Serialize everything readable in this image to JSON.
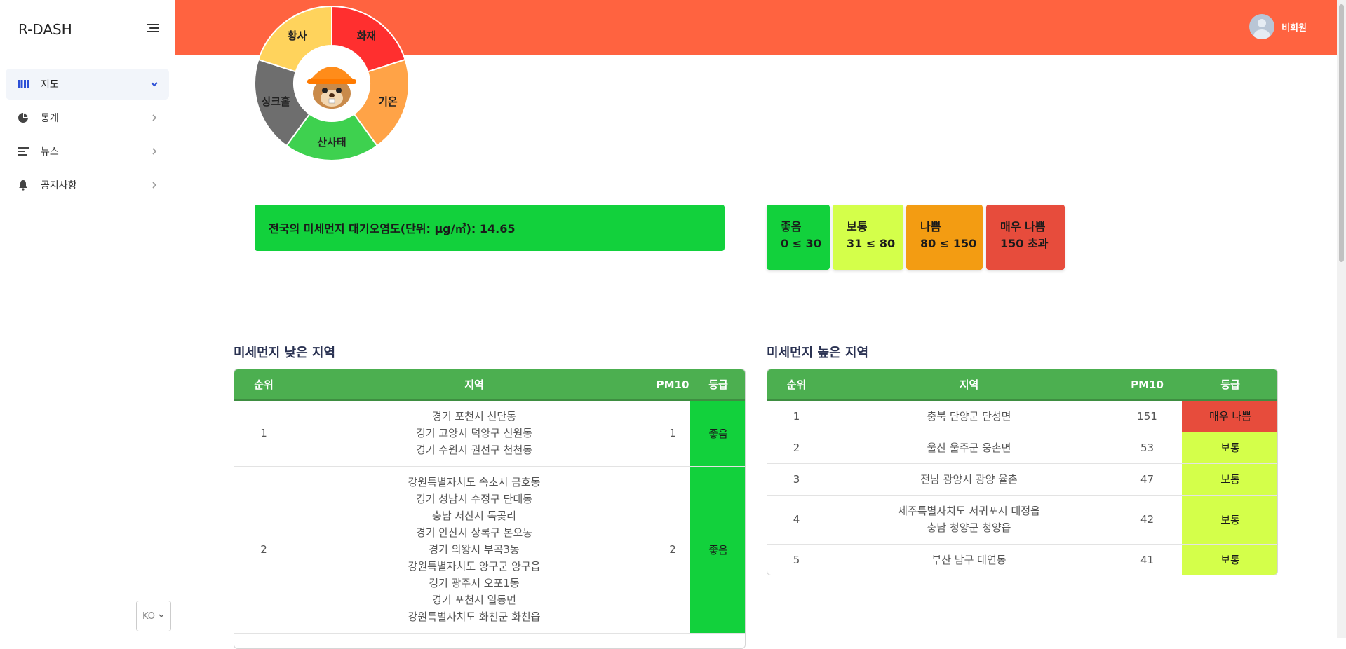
{
  "brand": "R-DASH",
  "sidebar": {
    "items": [
      {
        "label": "지도",
        "icon": "map-icon"
      },
      {
        "label": "통계",
        "icon": "pie-chart-icon"
      },
      {
        "label": "뉴스",
        "icon": "news-lines-icon"
      },
      {
        "label": "공지사항",
        "icon": "bell-icon"
      }
    ],
    "language": "KO"
  },
  "header": {
    "user_name": "비회원"
  },
  "disaster_wheel": {
    "segments": [
      {
        "label": "화재",
        "color": "#ff2f2f"
      },
      {
        "label": "기온",
        "color": "#ffa347"
      },
      {
        "label": "산사태",
        "color": "#3ed14f"
      },
      {
        "label": "싱크홀",
        "color": "#6e6e6e"
      },
      {
        "label": "황사",
        "color": "#ffd35c"
      }
    ],
    "mascot": "beaver-hardhat-mascot"
  },
  "national": {
    "text": "전국의 미세먼지 대기오염도(단위: μg/㎥): 14.65"
  },
  "grades": [
    {
      "name": "좋음",
      "range": "0 ≤ 30",
      "color": "#12d13c"
    },
    {
      "name": "보통",
      "range": "31 ≤ 80",
      "color": "#d4ff4a"
    },
    {
      "name": "나쁨",
      "range": "80 ≤ 150",
      "color": "#f39c12"
    },
    {
      "name": "매우 나쁨",
      "range": "150 초과",
      "color": "#e74c3c"
    }
  ],
  "low_table": {
    "title": "미세먼지 낮은 지역",
    "headers": [
      "순위",
      "지역",
      "PM10",
      "등급"
    ],
    "rows": [
      {
        "rank": "1",
        "regions": [
          "경기 포천시 선단동",
          "경기 고양시 덕양구 신원동",
          "경기 수원시 권선구 천천동"
        ],
        "pm10": "1",
        "grade": "좋음"
      },
      {
        "rank": "2",
        "regions": [
          "강원특별자치도 속초시 금호동",
          "경기 성남시 수정구 단대동",
          "충남 서산시 독곶리",
          "경기 안산시 상록구 본오동",
          "경기 의왕시 부곡3동",
          "강원특별자치도 양구군 양구읍",
          "경기 광주시 오포1동",
          "경기 포천시 일동면",
          "강원특별자치도 화천군 화천읍"
        ],
        "pm10": "2",
        "grade": "좋음"
      }
    ]
  },
  "high_table": {
    "title": "미세먼지 높은 지역",
    "headers": [
      "순위",
      "지역",
      "PM10",
      "등급"
    ],
    "rows": [
      {
        "rank": "1",
        "regions": [
          "충북 단양군 단성면"
        ],
        "pm10": "151",
        "grade": "매우 나쁨"
      },
      {
        "rank": "2",
        "regions": [
          "울산 울주군 웅촌면"
        ],
        "pm10": "53",
        "grade": "보통"
      },
      {
        "rank": "3",
        "regions": [
          "전남 광양시 광양 율촌"
        ],
        "pm10": "47",
        "grade": "보통"
      },
      {
        "rank": "4",
        "regions": [
          "제주특별자치도 서귀포시 대정읍",
          "충남 청양군 청양읍"
        ],
        "pm10": "42",
        "grade": "보통"
      },
      {
        "rank": "5",
        "regions": [
          "부산 남구 대연동"
        ],
        "pm10": "41",
        "grade": "보통"
      }
    ]
  }
}
